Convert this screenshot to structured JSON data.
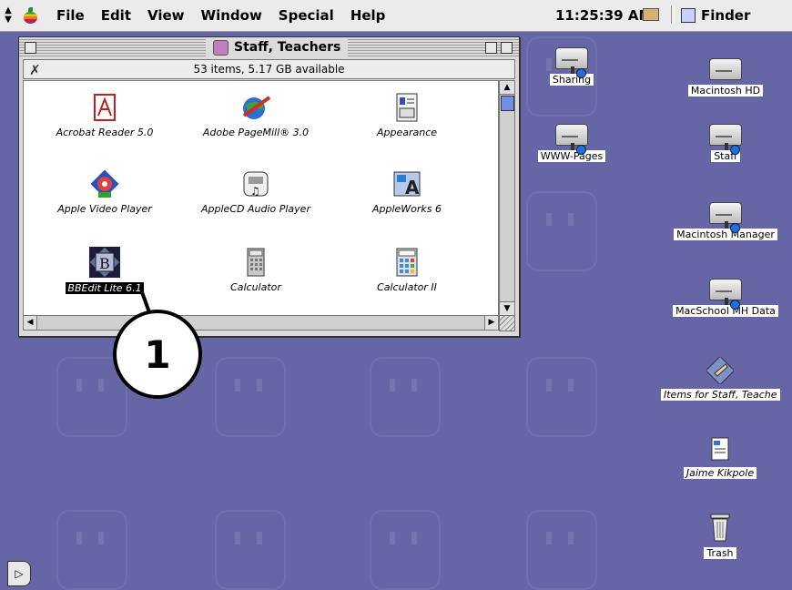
{
  "menubar": {
    "menus": [
      "File",
      "Edit",
      "View",
      "Window",
      "Special",
      "Help"
    ],
    "clock": "11:25:39 AM",
    "active_app": "Finder"
  },
  "window": {
    "title": "Staff, Teachers",
    "info": "53 items, 5.17 GB available",
    "items": [
      {
        "label": "Acrobat Reader 5.0",
        "icon": "acrobat-icon",
        "selected": false
      },
      {
        "label": "Adobe PageMill® 3.0",
        "icon": "pagemill-icon",
        "selected": false
      },
      {
        "label": "Appearance",
        "icon": "appearance-icon",
        "selected": false
      },
      {
        "label": "Apple Video Player",
        "icon": "video-player-icon",
        "selected": false
      },
      {
        "label": "AppleCD Audio Player",
        "icon": "cd-audio-icon",
        "selected": false
      },
      {
        "label": "AppleWorks 6",
        "icon": "appleworks-icon",
        "selected": false
      },
      {
        "label": "BBEdit Lite 6.1",
        "icon": "bbedit-icon",
        "selected": true
      },
      {
        "label": "Calculator",
        "icon": "calculator-icon",
        "selected": false
      },
      {
        "label": "Calculator II",
        "icon": "calculator-ii-icon",
        "selected": false
      }
    ]
  },
  "desktop": {
    "icons": [
      {
        "label": "Sharing",
        "type": "network-disk",
        "italic": false
      },
      {
        "label": "Macintosh HD",
        "type": "disk",
        "italic": false
      },
      {
        "label": "WWW-Pages",
        "type": "network-disk",
        "italic": false
      },
      {
        "label": "Staff",
        "type": "network-disk",
        "italic": false
      },
      {
        "label": "Macintosh Manager",
        "type": "network-disk",
        "italic": false
      },
      {
        "label": "MacSchool MH Data",
        "type": "network-disk",
        "italic": false
      },
      {
        "label": "Items for Staff, Teache",
        "type": "alias-folder",
        "italic": true
      },
      {
        "label": "Jaime Kikpole",
        "type": "alias-document",
        "italic": true
      },
      {
        "label": "Trash",
        "type": "trash",
        "italic": false
      }
    ]
  },
  "callout": {
    "number": "1"
  }
}
